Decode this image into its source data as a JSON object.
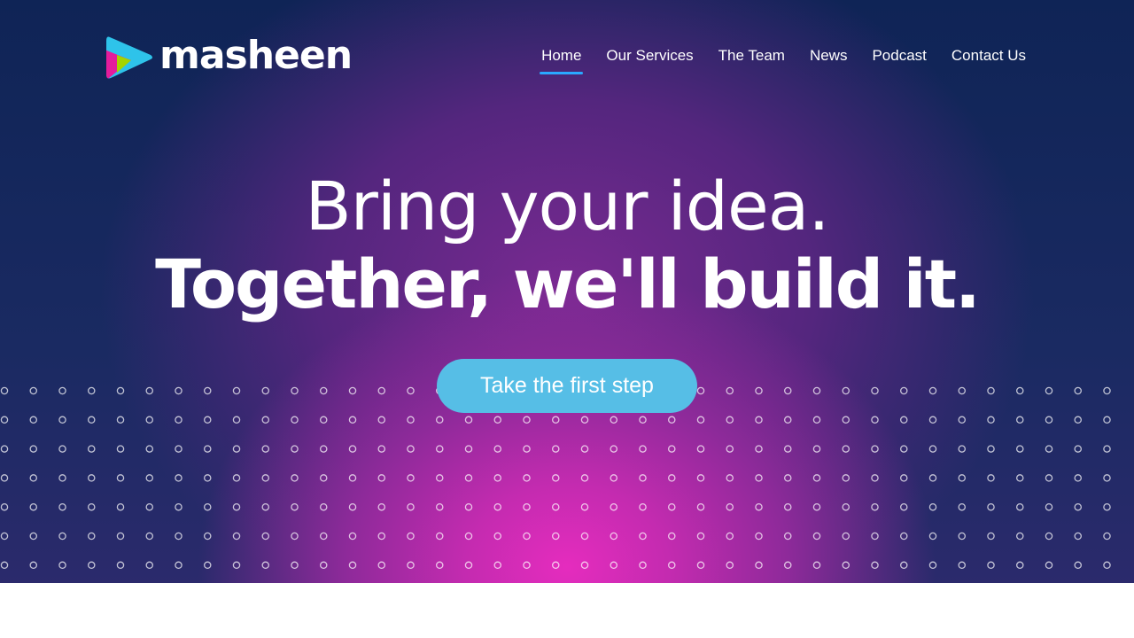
{
  "brand": {
    "name": "masheen",
    "logo_icon": "play-triangle-logo-icon",
    "colors": {
      "magenta": "#e41c9c",
      "lime": "#a5d400",
      "cyan": "#2ec3ea"
    }
  },
  "nav": {
    "items": [
      {
        "label": "Home",
        "active": true
      },
      {
        "label": "Our Services",
        "active": false
      },
      {
        "label": "The Team",
        "active": false
      },
      {
        "label": "News",
        "active": false
      },
      {
        "label": "Podcast",
        "active": false
      },
      {
        "label": "Contact Us",
        "active": false
      }
    ],
    "active_underline_color": "#2aa8ff"
  },
  "hero": {
    "headline_line1": "Bring your idea.",
    "headline_line2": "Together, we'll build it.",
    "cta_label": "Take the first step",
    "cta_color": "#56bee6",
    "background": {
      "top_color": "#0f2456",
      "mid_color": "#54267e",
      "glow_color": "#e52cbe"
    },
    "pattern": "dot-grid-pattern"
  }
}
